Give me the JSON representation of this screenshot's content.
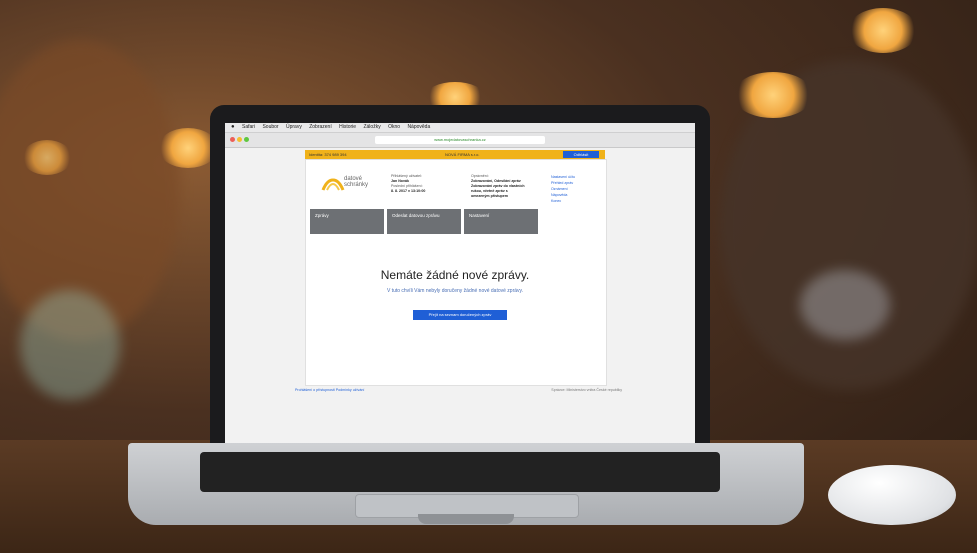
{
  "mac_menubar": {
    "items": [
      "Safari",
      "Soubor",
      "Úpravy",
      "Zobrazení",
      "Historie",
      "Záložky",
      "Okno",
      "Nápověda"
    ]
  },
  "browser": {
    "url": "www.mojedatovaschranka.cz"
  },
  "top_bar": {
    "left_text": "Identita: 374 989 394",
    "middle_text": "NOVÁ FIRMA s.r.o.",
    "logout_label": "Odhlásit"
  },
  "logo": {
    "line1": "datové",
    "line2": "schránky"
  },
  "account_info": {
    "col1": [
      "Přihlášený uživatel:",
      "Jan Novák",
      "",
      "Poslední přihlášení:",
      "8. 8. 2017 v 13:10:00"
    ],
    "col2": [
      "Oprávnění:",
      "Zobrazování, Odesílání zpráv",
      "Zobrazování zpráv do vlastních",
      "rukou, včetně zpráv s",
      "omezeným přístupem"
    ]
  },
  "side_links": [
    "Nastavení účtu",
    "Přehled zpráv",
    "Oznámení",
    "Nápověda",
    "Konec"
  ],
  "tabs": [
    "Zprávy",
    "Odeslat datovou zprávu",
    "Nastavení"
  ],
  "empty_state": {
    "title": "Nemáte žádné nové zprávy.",
    "subtitle": "V tuto chvíli Vám nebyly doručeny žádné nové datové zprávy.",
    "button_label": "Přejít na seznam doručených zpráv"
  },
  "footer": {
    "left": "Prohlášení o přístupnosti   Podmínky užívání",
    "right": "Správce: Ministerstvo vnitra České republiky"
  },
  "colors": {
    "accent_blue": "#1f5fd6",
    "brand_yellow": "#f0b21a",
    "tab_gray": "#6d7074"
  }
}
